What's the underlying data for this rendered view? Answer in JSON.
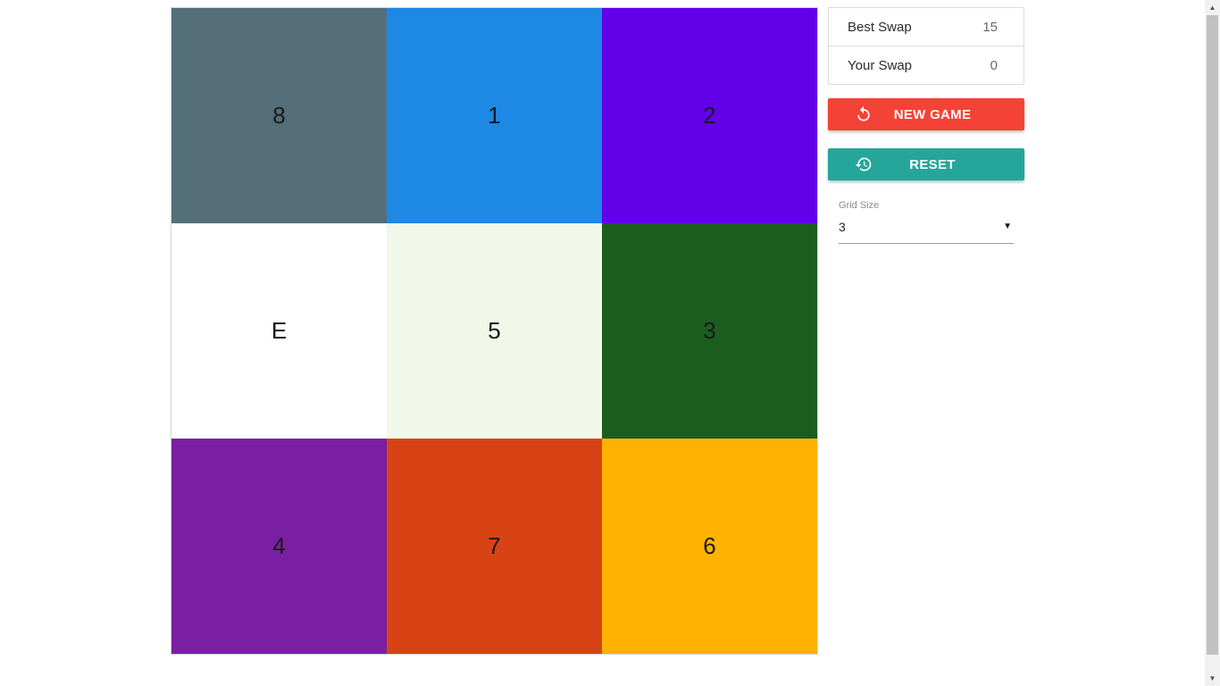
{
  "board": {
    "grid_size": 3,
    "tiles": [
      {
        "label": "8",
        "color": "#546e7a"
      },
      {
        "label": "1",
        "color": "#1e88e5"
      },
      {
        "label": "2",
        "color": "#6200ea"
      },
      {
        "label": "E",
        "color": "#ffffff"
      },
      {
        "label": "5",
        "color": "#f1f8e9"
      },
      {
        "label": "3",
        "color": "#1b5e20"
      },
      {
        "label": "4",
        "color": "#7b1fa2"
      },
      {
        "label": "7",
        "color": "#d84315"
      },
      {
        "label": "6",
        "color": "#ffb300"
      }
    ]
  },
  "stats": {
    "best_swap_label": "Best Swap",
    "best_swap_value": "15",
    "your_swap_label": "Your Swap",
    "your_swap_value": "0"
  },
  "buttons": {
    "new_game_label": "NEW GAME",
    "new_game_icon": "refresh-icon",
    "new_game_color": "#f44336",
    "reset_label": "RESET",
    "reset_icon": "history-icon",
    "reset_color": "#26a69a"
  },
  "grid_select": {
    "label": "Grid Size",
    "value": "3",
    "arrow": "▼"
  },
  "scrollbar": {
    "up_arrow": "▲",
    "down_arrow": "▼"
  }
}
